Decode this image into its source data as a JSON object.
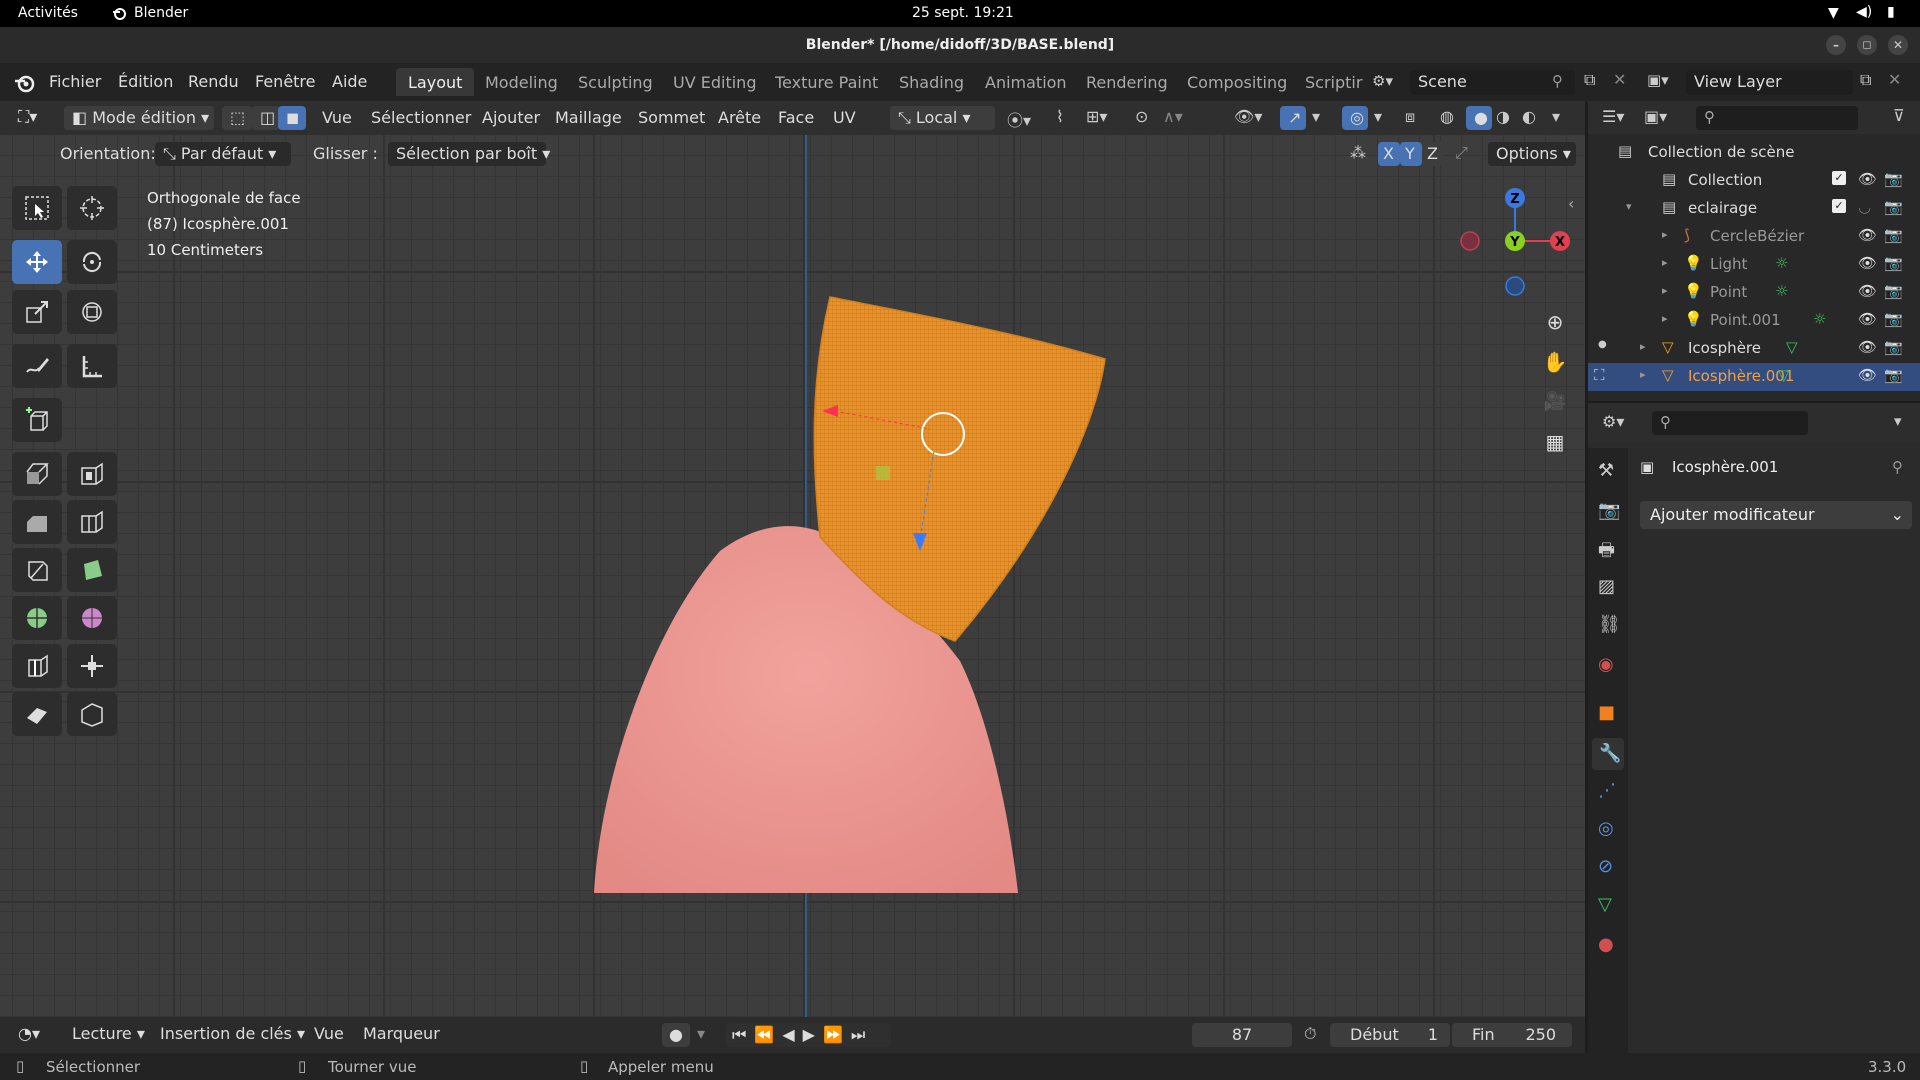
{
  "system_bar": {
    "activities": "Activités",
    "app": "Blender",
    "datetime": "25 sept.  19:21"
  },
  "window": {
    "title": "Blender* [/home/didoff/3D/BASE.blend]"
  },
  "menu": {
    "items": [
      "Fichier",
      "Édition",
      "Rendu",
      "Fenêtre",
      "Aide"
    ]
  },
  "workspaces": {
    "tabs": [
      "Layout",
      "Modeling",
      "Sculpting",
      "UV Editing",
      "Texture Paint",
      "Shading",
      "Animation",
      "Rendering",
      "Compositing",
      "Scriptir"
    ],
    "active": "Layout"
  },
  "scene": {
    "name": "Scene",
    "view_layer": "View Layer"
  },
  "header3d": {
    "mode": "Mode édition",
    "menus": [
      "Vue",
      "Sélectionner",
      "Ajouter",
      "Maillage",
      "Sommet",
      "Arête",
      "Face",
      "UV"
    ],
    "transform": "Local"
  },
  "tool_options": {
    "orientation_label": "Orientation:",
    "orientation_value": "Par défaut",
    "drag_label": "Glisser :",
    "drag_value": "Sélection par boît",
    "mirror_axes": [
      "X",
      "Y",
      "Z"
    ],
    "options": "Options"
  },
  "viewport_info": {
    "view": "Orthogonale de face",
    "object": "(87) Icosphère.001",
    "scale": "10 Centimeters"
  },
  "gizmo": {
    "z": "Z",
    "y": "Y",
    "x": "X"
  },
  "colors": {
    "mesh_orange": "#e8922b",
    "body_pink": "#e99590",
    "select_blue": "#4772b3"
  },
  "outliner": {
    "root": "Collection de scène",
    "rows": [
      {
        "label": "Collection",
        "indent": 1
      },
      {
        "label": "eclairage",
        "indent": 1
      },
      {
        "label": "CercleBézier",
        "indent": 2
      },
      {
        "label": "Light",
        "indent": 2
      },
      {
        "label": "Point",
        "indent": 2
      },
      {
        "label": "Point.001",
        "indent": 2
      },
      {
        "label": "Icosphère",
        "indent": 1
      },
      {
        "label": "Icosphère.001",
        "indent": 1,
        "selected": true
      }
    ]
  },
  "properties": {
    "object_name": "Icosphère.001",
    "add_modifier": "Ajouter modificateur"
  },
  "timeline": {
    "playback": "Lecture",
    "keying": "Insertion de clés",
    "view": "Vue",
    "marker": "Marqueur",
    "current_frame": "87",
    "start_label": "Début",
    "start": "1",
    "end_label": "Fin",
    "end": "250"
  },
  "statusbar": {
    "select": "Sélectionner",
    "rotate": "Tourner vue",
    "menu": "Appeler menu",
    "version": "3.3.0"
  }
}
